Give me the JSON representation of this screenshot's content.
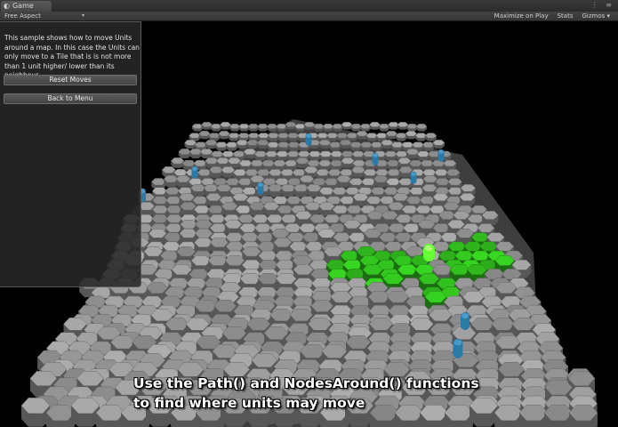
{
  "window": {
    "tab_icon": "unity-icon",
    "tab_label": "Game",
    "window_icons": "⋮ ≡"
  },
  "toolbar": {
    "aspect_label": "Free Aspect",
    "aspect_arrow": "▾",
    "maximize_label": "Maximize on Play",
    "stats_label": "Stats",
    "gizmos_label": "Gizmos ▾"
  },
  "panel": {
    "description": "This sample shows how to move Units around a map. In this case the Units can only move to a Tile that is is not more than 1 unit higher/ lower than its neighbour.",
    "reset_label": "Reset Moves",
    "back_label": "Back to Menu"
  },
  "caption": {
    "line1": "Use the Path() and NodesAround() functions",
    "line2": "to find where units may move"
  },
  "colors": {
    "tile_grey": "#9e9e9e",
    "tile_green": "#33c51f",
    "unit_blue": "#2a7aa8",
    "selected_unit": "#66ff33"
  }
}
